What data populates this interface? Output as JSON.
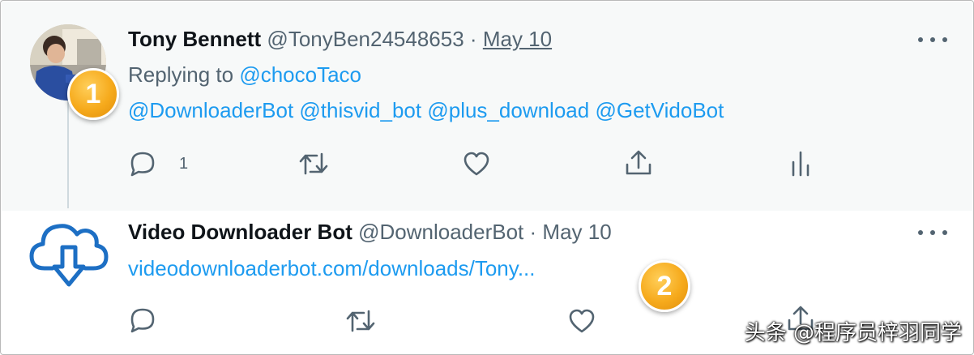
{
  "tweets": [
    {
      "author_name": "Tony Bennett",
      "author_handle": "@TonyBen24548653",
      "separator": "·",
      "date": "May 10",
      "replying_prefix": "Replying to",
      "replying_to": "@chocoTaco",
      "mentions": [
        "@DownloaderBot",
        "@thisvid_bot",
        "@plus_download",
        "@GetVidoBot"
      ],
      "reply_count": "1",
      "badge": "1"
    },
    {
      "author_name": "Video Downloader Bot",
      "author_handle": "@DownloaderBot",
      "separator": "·",
      "date": "May 10",
      "link_text": "videodownloaderbot.com/downloads/Tony...",
      "badge": "2"
    }
  ],
  "watermark": "头条 @程序员梓羽同学",
  "colors": {
    "link": "#1d9bf0",
    "secondary_text": "#536471",
    "badge": "#f6aa1c",
    "tweet_highlight_bg": "#f7f9f9"
  },
  "icons": [
    "reply-icon",
    "retweet-icon",
    "like-icon",
    "share-icon",
    "analytics-icon",
    "more-icon",
    "cloud-download-icon"
  ]
}
